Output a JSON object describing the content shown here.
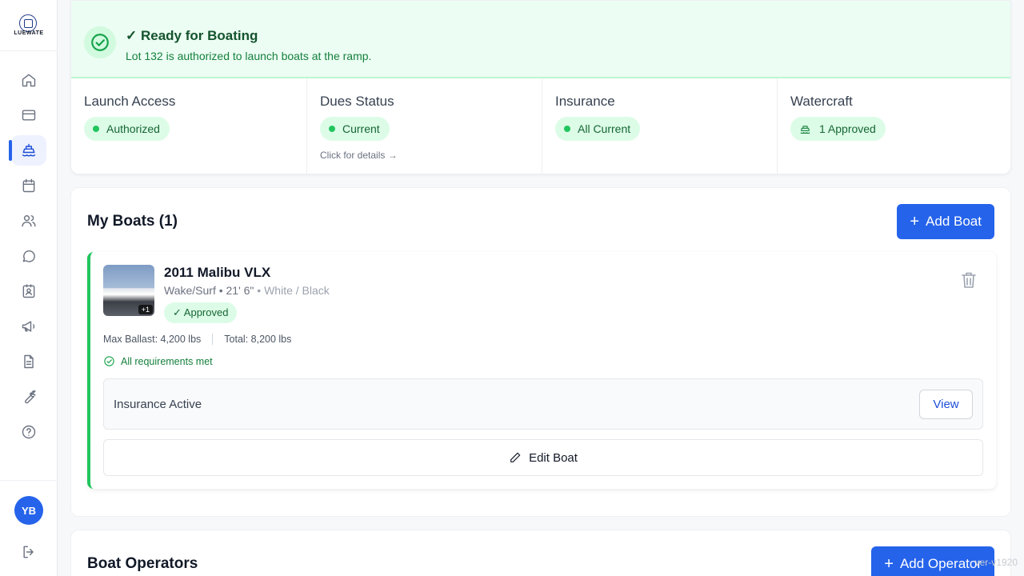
{
  "brand": {
    "logo_text": "LUEWATE"
  },
  "sidebar": {
    "items": [
      {
        "name": "home",
        "icon": "home-icon"
      },
      {
        "name": "billing",
        "icon": "credit-card-icon"
      },
      {
        "name": "boats",
        "icon": "boat-icon",
        "active": true
      },
      {
        "name": "calendar",
        "icon": "calendar-icon"
      },
      {
        "name": "members",
        "icon": "users-icon"
      },
      {
        "name": "messages",
        "icon": "chat-icon"
      },
      {
        "name": "directory",
        "icon": "contact-card-icon"
      },
      {
        "name": "announcements",
        "icon": "megaphone-icon"
      },
      {
        "name": "documents",
        "icon": "document-icon"
      },
      {
        "name": "maintenance",
        "icon": "wrench-icon"
      },
      {
        "name": "help",
        "icon": "help-icon"
      }
    ],
    "avatar_initials": "YB",
    "logout_icon": "logout-icon"
  },
  "status": {
    "banner_title": "✓ Ready for Boating",
    "banner_subtitle": "Lot 132 is authorized to launch boats at the ramp.",
    "stats": [
      {
        "label": "Launch Access",
        "value": "Authorized"
      },
      {
        "label": "Dues Status",
        "value": "Current",
        "link": "Click for details →"
      },
      {
        "label": "Insurance",
        "value": "All Current"
      },
      {
        "label": "Watercraft",
        "value": "1 Approved"
      }
    ]
  },
  "boats": {
    "title": "My Boats (1)",
    "add_label": "Add Boat",
    "items": [
      {
        "name": "2011 Malibu VLX",
        "meta": "Wake/Surf • 21' 6\"",
        "color": "• White / Black",
        "photo_extra": "+1",
        "status": "✓ Approved",
        "max_ballast": "Max Ballast: 4,200 lbs",
        "total": "Total: 8,200 lbs",
        "requirements": "All requirements met",
        "insurance_label": "Insurance Active",
        "view_label": "View",
        "edit_label": "Edit Boat"
      }
    ]
  },
  "operators": {
    "title": "Boat Operators",
    "add_label": "Add Operator"
  },
  "watermark": "ver-v1920",
  "colors": {
    "accent": "#2563eb",
    "success": "#22c55e",
    "success_bg": "#ecfdf3"
  }
}
